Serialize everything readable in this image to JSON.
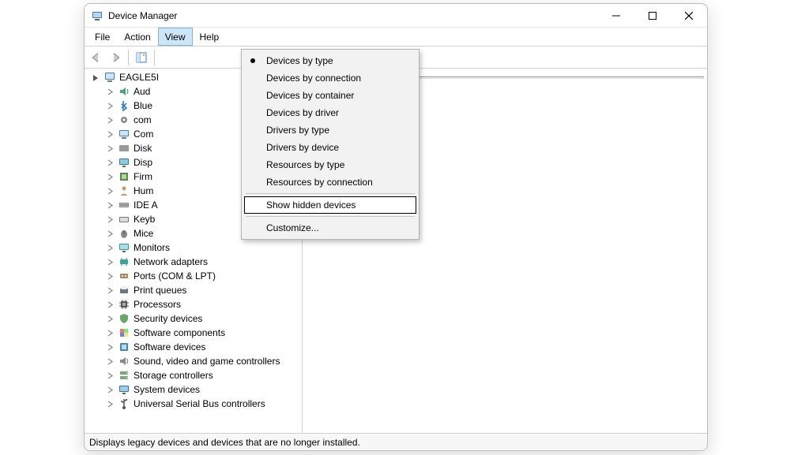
{
  "window": {
    "title": "Device Manager"
  },
  "menubar": {
    "file": "File",
    "action": "Action",
    "view": "View",
    "help": "Help"
  },
  "dropdown": {
    "devices_by_type": "Devices by type",
    "devices_by_connection": "Devices by connection",
    "devices_by_container": "Devices by container",
    "devices_by_driver": "Devices by driver",
    "drivers_by_type": "Drivers by type",
    "drivers_by_device": "Drivers by device",
    "resources_by_type": "Resources by type",
    "resources_by_connection": "Resources by connection",
    "show_hidden": "Show hidden devices",
    "customize": "Customize..."
  },
  "tree": {
    "root": "EAGLE5I",
    "items": [
      "Aud",
      "Blue",
      "com",
      "Com",
      "Disk",
      "Disp",
      "Firm",
      "Hum",
      "IDE A",
      "Keyb",
      "Mice",
      "Monitors",
      "Network adapters",
      "Ports (COM & LPT)",
      "Print queues",
      "Processors",
      "Security devices",
      "Software components",
      "Software devices",
      "Sound, video and game controllers",
      "Storage controllers",
      "System devices",
      "Universal Serial Bus controllers"
    ]
  },
  "status": {
    "text": "Displays legacy devices and devices that are no longer installed."
  }
}
